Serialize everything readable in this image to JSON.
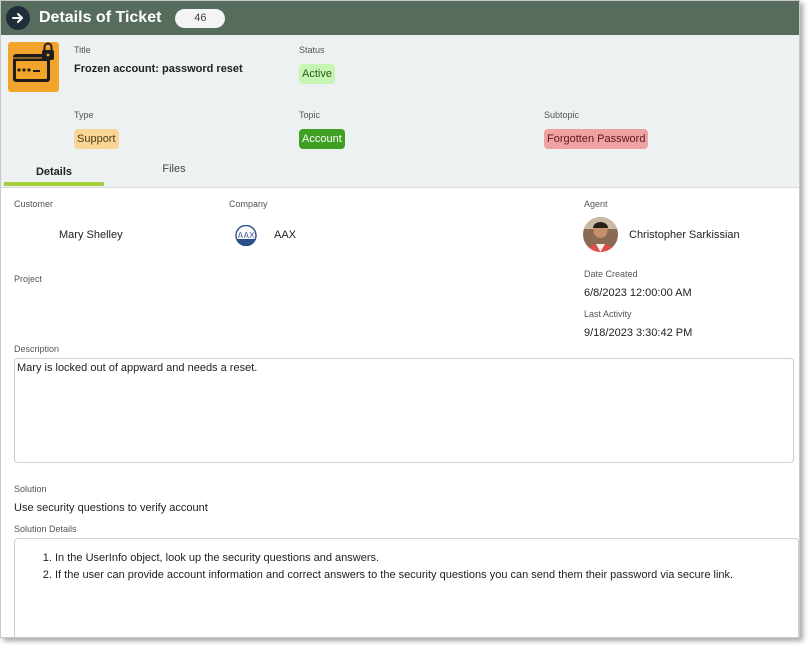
{
  "header": {
    "title": "Details of Ticket",
    "ticket_count": "46"
  },
  "ticket": {
    "title_label": "Title",
    "title_value": "Frozen account: password reset",
    "status_label": "Status",
    "status_value": "Active",
    "type_label": "Type",
    "type_value": "Support",
    "topic_label": "Topic",
    "topic_value": "Account",
    "subtopic_label": "Subtopic",
    "subtopic_value": "Forgotten Password",
    "icon": "password-lock-icon"
  },
  "tabs": [
    {
      "label": "Details",
      "active": true
    },
    {
      "label": "Files",
      "active": false
    }
  ],
  "details": {
    "customer_label": "Customer",
    "customer_value": "Mary Shelley",
    "company_label": "Company",
    "company_value": "AAX",
    "company_logo_text": "AAX",
    "agent_label": "Agent",
    "agent_value": "Christopher Sarkissian",
    "project_label": "Project",
    "date_created_label": "Date Created",
    "date_created_value": "6/8/2023 12:00:00 AM",
    "last_activity_label": "Last Activity",
    "last_activity_value": "9/18/2023 3:30:42 PM",
    "description_label": "Description",
    "description_value": "Mary is locked out of appward and needs a reset.",
    "solution_label": "Solution",
    "solution_value": "Use security questions to verify account",
    "solution_details_label": "Solution Details",
    "solution_details_items": [
      "In the UserInfo object, look up the security questions and answers.",
      "If the user can provide account information and correct answers to the security questions you can send them their password via secure link."
    ]
  },
  "colors": {
    "titlebar": "#566d5e",
    "status_chip": "#c6f5b4",
    "type_chip": "#f9d596",
    "topic_chip": "#3e9f23",
    "subtopic_chip": "#f0a1a1",
    "tab_accent": "#a3cf3a",
    "icon_bg": "#f2a52a"
  }
}
